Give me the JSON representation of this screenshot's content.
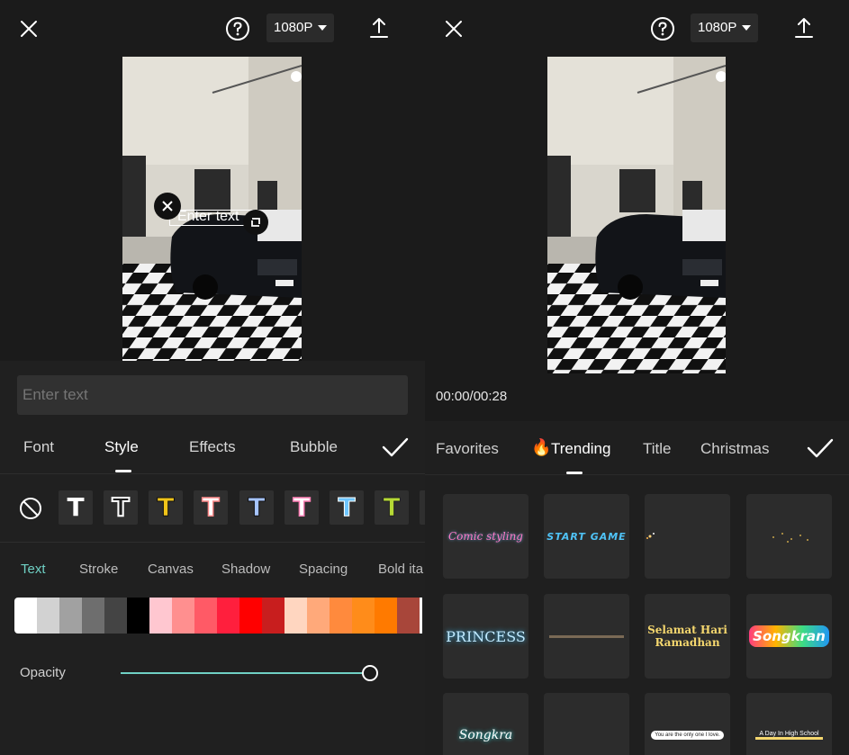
{
  "left": {
    "resolution": "1080P",
    "overlay_text": "Enter text",
    "text_input_placeholder": "Enter text",
    "tabs": [
      "Font",
      "Style",
      "Effects",
      "Bubble"
    ],
    "active_tab": "Style",
    "subtabs": [
      "Text",
      "Stroke",
      "Canvas",
      "Shadow",
      "Spacing",
      "Bold ita"
    ],
    "active_subtab": "Text",
    "text_style_colors": [
      "#ffffff",
      "#ffffff",
      "#f0c419",
      "#ff8a8a",
      "#a6c4ff",
      "#ff7fb5",
      "#6ec6ff",
      "#b6d935"
    ],
    "palette": [
      "#ffffff",
      "#d2d2d2",
      "#a1a1a1",
      "#6e6e6e",
      "#444444",
      "#000000",
      "#ffc7d0",
      "#ff8f8f",
      "#ff5a66",
      "#ff1f3d",
      "#ff0000",
      "#c81e1e",
      "#ffd6c0",
      "#ffa97a",
      "#ff8a3d",
      "#ff8c1a",
      "#ff7a00",
      "#a8463a",
      "#ffffff"
    ],
    "opacity_label": "Opacity",
    "opacity_value": 1.0
  },
  "right": {
    "resolution": "1080P",
    "timecode": "00:00/00:28",
    "tabs": [
      "Favorites",
      "Trending",
      "Title",
      "Christmas"
    ],
    "active_tab": "Trending",
    "trending_icon": "fire-icon",
    "templates": [
      {
        "text": "Comic styling"
      },
      {
        "text": "START GAME"
      },
      {
        "text": ""
      },
      {
        "text": ""
      },
      {
        "text": "PRINCESS"
      },
      {
        "text": ""
      },
      {
        "text": "Selamat Hari Ramadhan"
      },
      {
        "text": "Songkran"
      },
      {
        "text": "Songkra"
      },
      {
        "text": ""
      },
      {
        "text": "You are the only one I love."
      },
      {
        "text": "A Day In High School"
      }
    ]
  },
  "colors": {
    "accent": "#6fd0c4",
    "background": "#1b1b1b"
  }
}
